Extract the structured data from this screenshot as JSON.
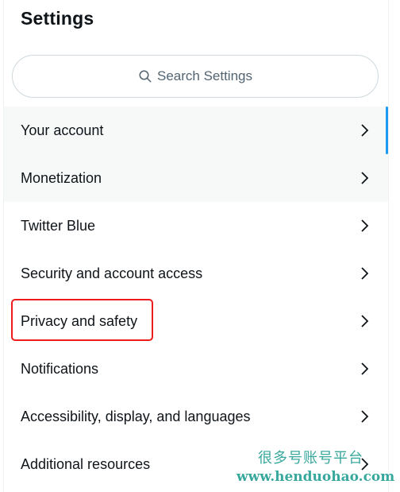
{
  "header": {
    "title": "Settings"
  },
  "search": {
    "placeholder": "Search Settings",
    "icon": "search-icon"
  },
  "menu": {
    "items": [
      {
        "label": "Your account"
      },
      {
        "label": "Monetization"
      },
      {
        "label": "Twitter Blue"
      },
      {
        "label": "Security and account access"
      },
      {
        "label": "Privacy and safety"
      },
      {
        "label": "Notifications"
      },
      {
        "label": "Accessibility, display, and languages"
      },
      {
        "label": "Additional resources"
      }
    ]
  },
  "watermark": {
    "chinese": "很多号账号平台",
    "url": "www.henduohao.com"
  },
  "colors": {
    "text": "#0f1419",
    "muted": "#536471",
    "highlight_border": "#ee1c1c",
    "accent": "#1d9bf0",
    "watermark": "#38a89d"
  }
}
